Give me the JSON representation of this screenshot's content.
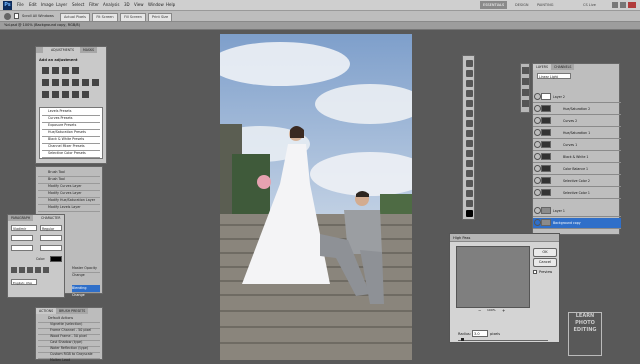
{
  "menubar": {
    "app_badge": "Ps",
    "items": [
      "File",
      "Edit",
      "Image",
      "Layer",
      "Select",
      "Filter",
      "Analysis",
      "3D",
      "View",
      "Window",
      "Help"
    ],
    "workspaces": [
      "ESSENTIALS",
      "DESIGN",
      "PAINTING"
    ],
    "search_label": "CS Live"
  },
  "optbar": {
    "scroll_all": "Scroll All Windows",
    "buttons": [
      "Actual Pixels",
      "Fit Screen",
      "Fill Screen",
      "Print Size"
    ]
  },
  "document": {
    "tab_title": "%d.psd @ 100% (Background copy, RGB/8)"
  },
  "adjustments": {
    "tabs": [
      "ADJUSTMENTS",
      "MASKS"
    ],
    "heading": "Add an adjustment",
    "presets": [
      "Levels Presets",
      "Curves Presets",
      "Exposure Presets",
      "Hue/Saturation Presets",
      "Black & White Presets",
      "Channel Mixer Presets",
      "Selective Color Presets"
    ]
  },
  "history": {
    "items": [
      "Brush Tool",
      "Brush Tool",
      "Modify Curves Layer",
      "Modify Curves Layer",
      "Modify Hue/Saturation Layer",
      "Modify Levels Layer",
      "Master Opacity Change",
      "Blending Change"
    ]
  },
  "paragraph": {
    "tabs": [
      "PARAGRAPH",
      "CHARACTER"
    ],
    "font": "Vladimir",
    "style": "Regular",
    "color_label": "Color:",
    "lang": "English: USA"
  },
  "actions": {
    "tabs": [
      "ACTIONS",
      "BRUSH PRESETS"
    ],
    "items": [
      "Default Actions",
      "Vignette (selection)",
      "Frame Channel - 50 pixel",
      "Wood Frame - 50 pixel",
      "Cast Shadow (type)",
      "Water Reflection (type)",
      "Custom RGB to Grayscale",
      "Molten Lead"
    ]
  },
  "layers": {
    "tabs": [
      "LAYERS",
      "CHANNELS"
    ],
    "blend_mode": "Linear Light",
    "items": [
      "Layer 2",
      "Hue/Saturation 2",
      "Curves 2",
      "Hue/Saturation 1",
      "Curves 1",
      "Black & White 1",
      "Color Balance 1",
      "Selective Color 2",
      "Selective Color 1",
      "Layer 1",
      "Background copy"
    ]
  },
  "high_pass": {
    "title": "High Pass",
    "ok": "OK",
    "cancel": "Cancel",
    "preview_label": "Preview",
    "zoom": "100%",
    "radius_label": "Radius:",
    "radius_value": "3.0",
    "radius_unit": "pixels"
  },
  "watermark": {
    "lines": [
      "LEARN",
      "PHOTO",
      "EDITING"
    ]
  },
  "colors": {
    "sky": "#5d86b8",
    "stone": "#7e7a72",
    "selection": "#2f6fc9"
  }
}
